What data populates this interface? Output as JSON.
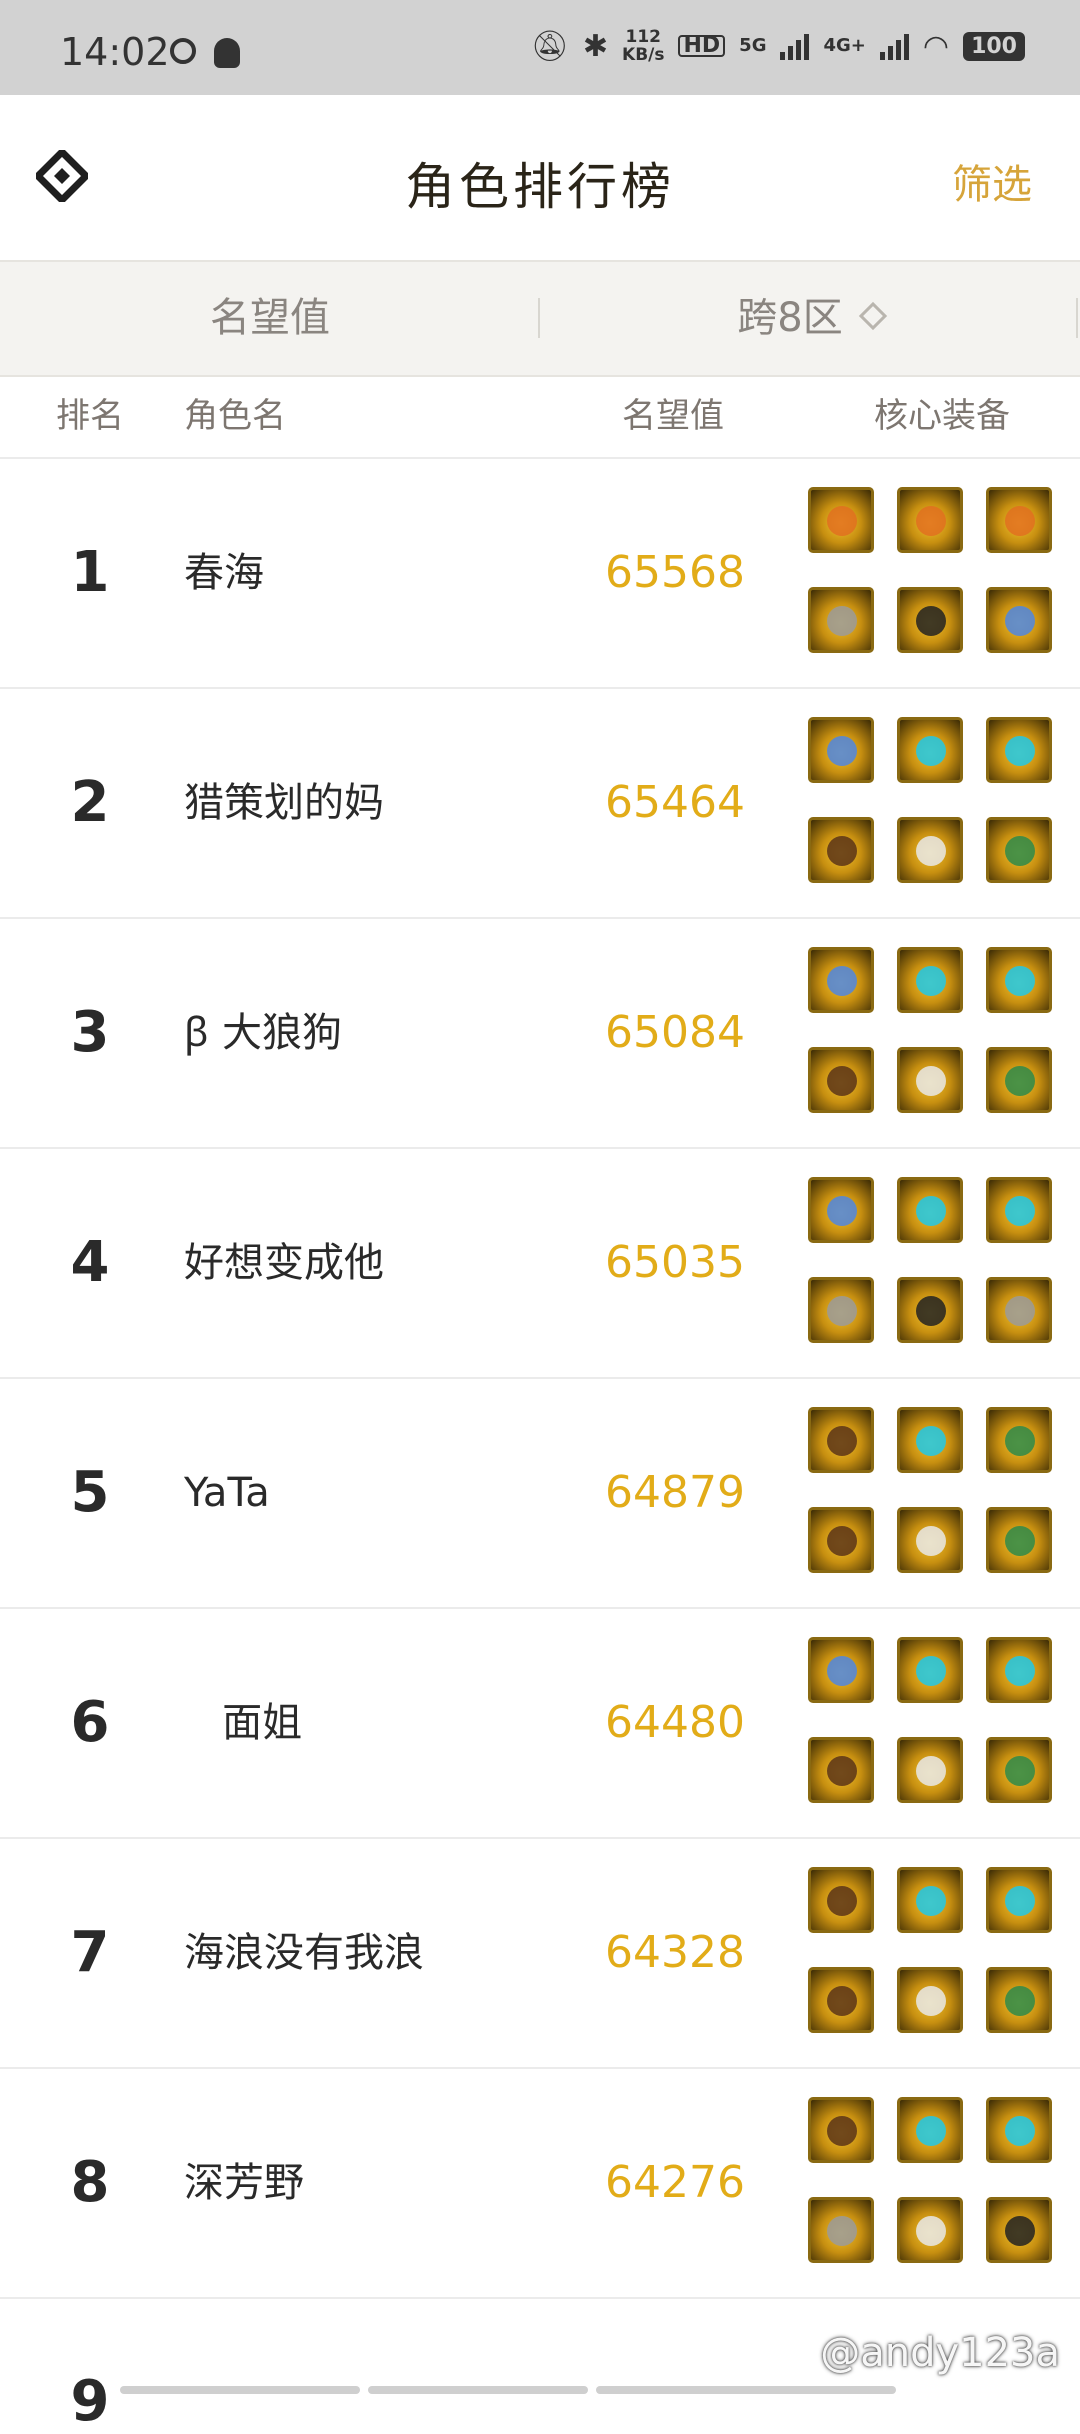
{
  "status_bar": {
    "time": "14:02",
    "speed_top": "112",
    "speed_bottom": "KB/s",
    "hd_label": "HD",
    "net5g": "5G",
    "net4g": "4G+",
    "battery": "100"
  },
  "header": {
    "title": "角色排行榜",
    "filter_label": "筛选",
    "logo_icon": "diamond-logo-icon"
  },
  "filter_bar": {
    "sort_label": "名望值",
    "region_label": "跨8区"
  },
  "table": {
    "columns": [
      "排名",
      "角色名",
      "名望值",
      "核心装备"
    ],
    "rows": [
      {
        "rank": "1",
        "name": "春海",
        "score": "65568",
        "equipment": [
          "orange",
          "orange",
          "orange",
          "gray",
          "dark",
          "blue"
        ]
      },
      {
        "rank": "2",
        "name": "猎策划的妈",
        "score": "65464",
        "equipment": [
          "blue",
          "cyan",
          "cyan",
          "brown",
          "white",
          "green"
        ]
      },
      {
        "rank": "3",
        "name": "ꞵ 大狼狗",
        "score": "65084",
        "equipment": [
          "blue",
          "cyan",
          "cyan",
          "brown",
          "white",
          "green"
        ]
      },
      {
        "rank": "4",
        "name": "好想变成他",
        "score": "65035",
        "equipment": [
          "blue",
          "cyan",
          "cyan",
          "gray",
          "dark",
          "gray"
        ]
      },
      {
        "rank": "5",
        "name": "YaTa",
        "score": "64879",
        "equipment": [
          "brown",
          "cyan",
          "green",
          "brown",
          "white",
          "green"
        ]
      },
      {
        "rank": "6",
        "name": "   面姐",
        "score": "64480",
        "equipment": [
          "blue",
          "cyan",
          "cyan",
          "brown",
          "white",
          "green"
        ]
      },
      {
        "rank": "7",
        "name": "海浪没有我浪",
        "score": "64328",
        "equipment": [
          "brown",
          "cyan",
          "cyan",
          "brown",
          "white",
          "green"
        ]
      },
      {
        "rank": "8",
        "name": "深芳野",
        "score": "64276",
        "equipment": [
          "brown",
          "cyan",
          "cyan",
          "gray",
          "white",
          "dark"
        ]
      }
    ],
    "partial_rank": "9"
  },
  "watermark": "@andy123a",
  "colors": {
    "accent": "#d6a43a",
    "score": "#e2ac18",
    "status_bar_bg": "#d2d2d2",
    "filter_bar_bg": "#f4f3f0"
  }
}
